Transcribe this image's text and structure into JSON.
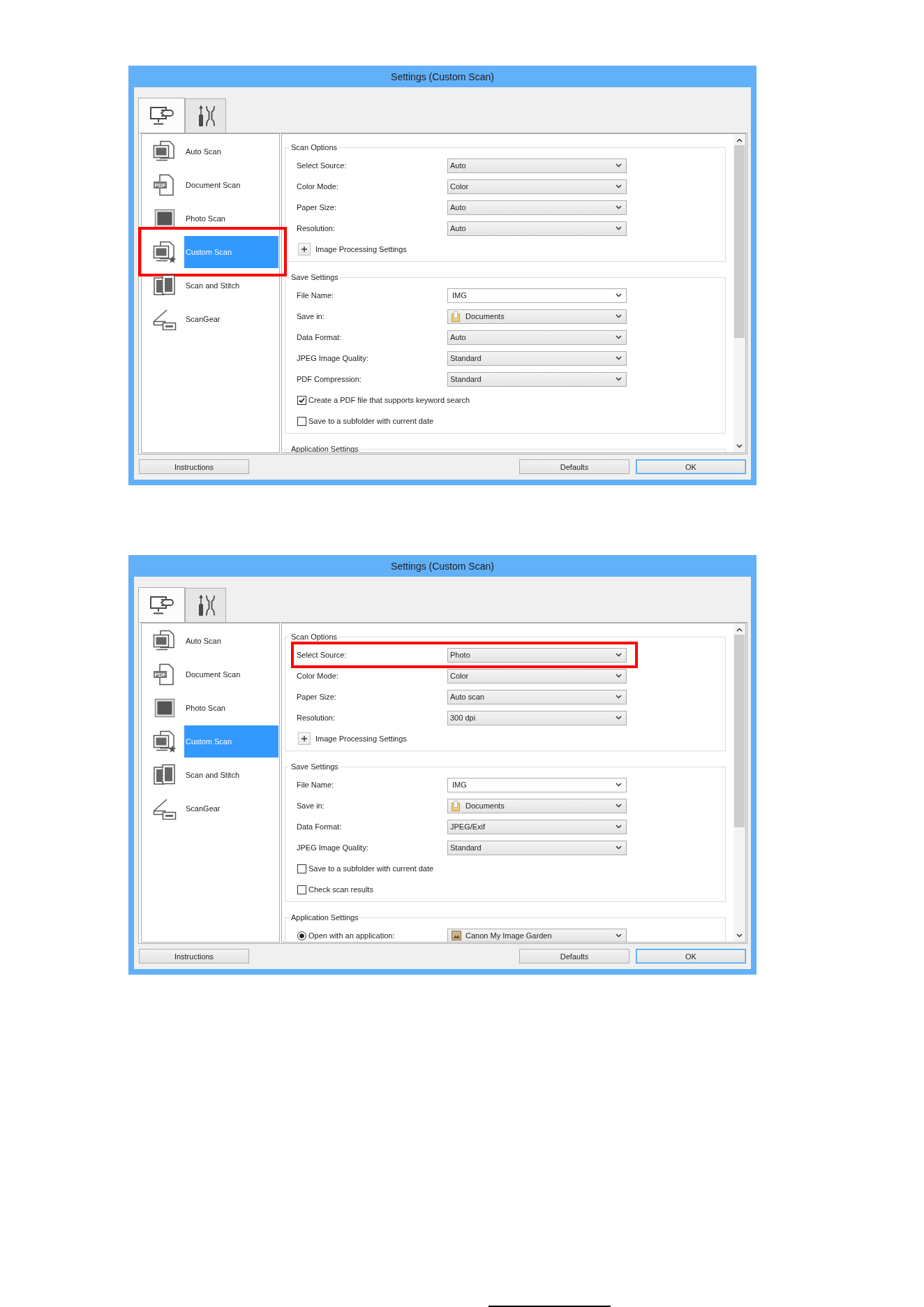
{
  "windows": [
    {
      "title": "Settings (Custom Scan)",
      "tabs": [
        {
          "kind": "scan",
          "selected": true
        },
        {
          "kind": "tools",
          "selected": false
        }
      ],
      "sidebar": {
        "items": [
          {
            "kind": "auto",
            "label": "Auto Scan",
            "selected": false,
            "highlighted": false
          },
          {
            "kind": "document",
            "label": "Document Scan",
            "icon_label": "PDF",
            "selected": false,
            "highlighted": false
          },
          {
            "kind": "photo",
            "label": "Photo Scan",
            "selected": false,
            "highlighted": false
          },
          {
            "kind": "custom",
            "label": "Custom Scan",
            "selected": true,
            "highlighted": true
          },
          {
            "kind": "stitch",
            "label": "Scan and Stitch",
            "selected": false,
            "highlighted": false
          },
          {
            "kind": "scangear",
            "label": "ScanGear",
            "selected": false,
            "highlighted": false
          }
        ]
      },
      "groups": [
        {
          "title": "Scan Options",
          "rows": [
            {
              "kind": "select",
              "label": "Select Source:",
              "value": "Auto",
              "highlighted": false
            },
            {
              "kind": "select",
              "label": "Color Mode:",
              "value": "Color",
              "highlighted": false
            },
            {
              "kind": "select",
              "label": "Paper Size:",
              "value": "Auto",
              "highlighted": false
            },
            {
              "kind": "select",
              "label": "Resolution:",
              "value": "Auto",
              "highlighted": false
            },
            {
              "kind": "expander",
              "label": "Image Processing Settings",
              "expanded": false,
              "highlighted": false
            }
          ]
        },
        {
          "title": "Save Settings",
          "rows": [
            {
              "kind": "combo",
              "label": "File Name:",
              "value": "IMG",
              "highlighted": false
            },
            {
              "kind": "location",
              "label": "Save in:",
              "value": "Documents",
              "highlighted": false
            },
            {
              "kind": "select",
              "label": "Data Format:",
              "value": "Auto",
              "highlighted": false
            },
            {
              "kind": "select",
              "label": "JPEG Image Quality:",
              "value": "Standard",
              "highlighted": false
            },
            {
              "kind": "select",
              "label": "PDF Compression:",
              "value": "Standard",
              "highlighted": false
            },
            {
              "kind": "checkbox",
              "label": "Create a PDF file that supports keyword search",
              "checked": true,
              "highlighted": false
            },
            {
              "kind": "checkbox",
              "label": "Save to a subfolder with current date",
              "checked": false,
              "highlighted": false
            }
          ]
        },
        {
          "title": "Application Settings"
        }
      ],
      "buttons": [
        {
          "label": "Instructions",
          "default": false
        },
        {
          "label": "Defaults",
          "default": false
        },
        {
          "label": "OK",
          "default": true
        }
      ]
    },
    {
      "title": "Settings (Custom Scan)",
      "tabs": [
        {
          "kind": "scan",
          "selected": true
        },
        {
          "kind": "tools",
          "selected": false
        }
      ],
      "sidebar": {
        "items": [
          {
            "kind": "auto",
            "label": "Auto Scan",
            "selected": false,
            "highlighted": false
          },
          {
            "kind": "document",
            "label": "Document Scan",
            "icon_label": "PDF",
            "selected": false,
            "highlighted": false
          },
          {
            "kind": "photo",
            "label": "Photo Scan",
            "selected": false,
            "highlighted": false
          },
          {
            "kind": "custom",
            "label": "Custom Scan",
            "selected": true,
            "highlighted": false
          },
          {
            "kind": "stitch",
            "label": "Scan and Stitch",
            "selected": false,
            "highlighted": false
          },
          {
            "kind": "scangear",
            "label": "ScanGear",
            "selected": false,
            "highlighted": false
          }
        ]
      },
      "groups": [
        {
          "title": "Scan Options",
          "rows": [
            {
              "kind": "select",
              "label": "Select Source:",
              "value": "Photo",
              "highlighted": true
            },
            {
              "kind": "select",
              "label": "Color Mode:",
              "value": "Color",
              "highlighted": false
            },
            {
              "kind": "select",
              "label": "Paper Size:",
              "value": "Auto scan",
              "highlighted": false
            },
            {
              "kind": "select",
              "label": "Resolution:",
              "value": "300 dpi",
              "highlighted": false
            },
            {
              "kind": "expander",
              "label": "Image Processing Settings",
              "expanded": false,
              "highlighted": false
            }
          ]
        },
        {
          "title": "Save Settings",
          "rows": [
            {
              "kind": "combo",
              "label": "File Name:",
              "value": "IMG",
              "highlighted": false
            },
            {
              "kind": "location",
              "label": "Save in:",
              "value": "Documents",
              "highlighted": false
            },
            {
              "kind": "select",
              "label": "Data Format:",
              "value": "JPEG/Exif",
              "highlighted": false
            },
            {
              "kind": "select",
              "label": "JPEG Image Quality:",
              "value": "Standard",
              "highlighted": false
            },
            {
              "kind": "checkbox",
              "label": "Save to a subfolder with current date",
              "checked": false,
              "highlighted": false
            },
            {
              "kind": "checkbox",
              "label": "Check scan results",
              "checked": false,
              "highlighted": false
            }
          ]
        },
        {
          "title": "Application Settings",
          "rows": [
            {
              "kind": "radio",
              "label": "Open with an application:",
              "selected": true,
              "value": "Canon My Image Garden",
              "highlighted": false
            }
          ]
        }
      ],
      "buttons": [
        {
          "label": "Instructions",
          "default": false
        },
        {
          "label": "Defaults",
          "default": false
        },
        {
          "label": "OK",
          "default": true
        }
      ]
    }
  ]
}
